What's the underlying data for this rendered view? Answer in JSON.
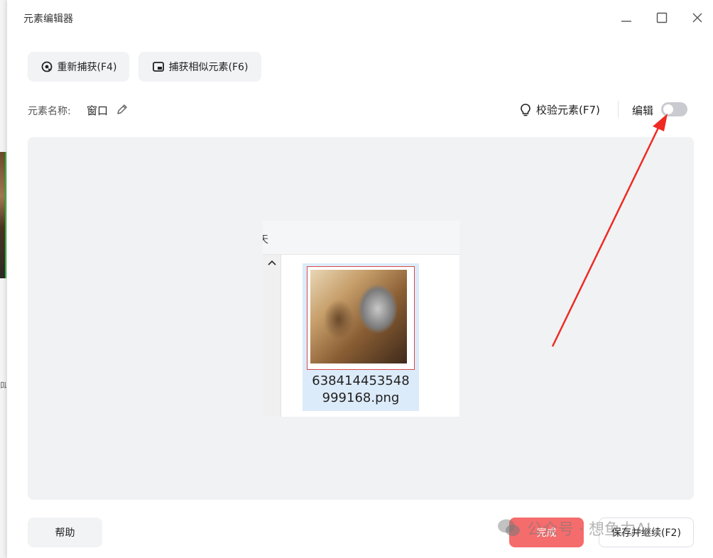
{
  "background": {
    "partial_char": "叫"
  },
  "window": {
    "title": "元素编辑器",
    "controls": [
      "minimize-icon",
      "maximize-icon",
      "close-icon"
    ]
  },
  "toolbar": {
    "recapture_label": "重新捕获(F4)",
    "capture_similar_label": "捕获相似元素(F6)"
  },
  "element": {
    "name_label": "元素名称:",
    "name_value": "窗口"
  },
  "verify": {
    "label": "校验元素(F7)"
  },
  "edit": {
    "label": "编辑",
    "enabled": false
  },
  "preview": {
    "top_partial_char": "天",
    "file": {
      "name_line1": "638414453548",
      "name_line2": "999168.png"
    }
  },
  "footer": {
    "help_label": "帮助",
    "done_label": "完成",
    "save_continue_label": "保存并继续(F2)"
  },
  "watermark": {
    "text": "公众号 · 想鱼力AI"
  },
  "colors": {
    "primary_danger": "#f56c6c",
    "toggle_off": "#c9cbd0",
    "annotation_arrow": "#ee2a22",
    "selection_border": "#d94848",
    "file_highlight": "#dcebf9"
  }
}
